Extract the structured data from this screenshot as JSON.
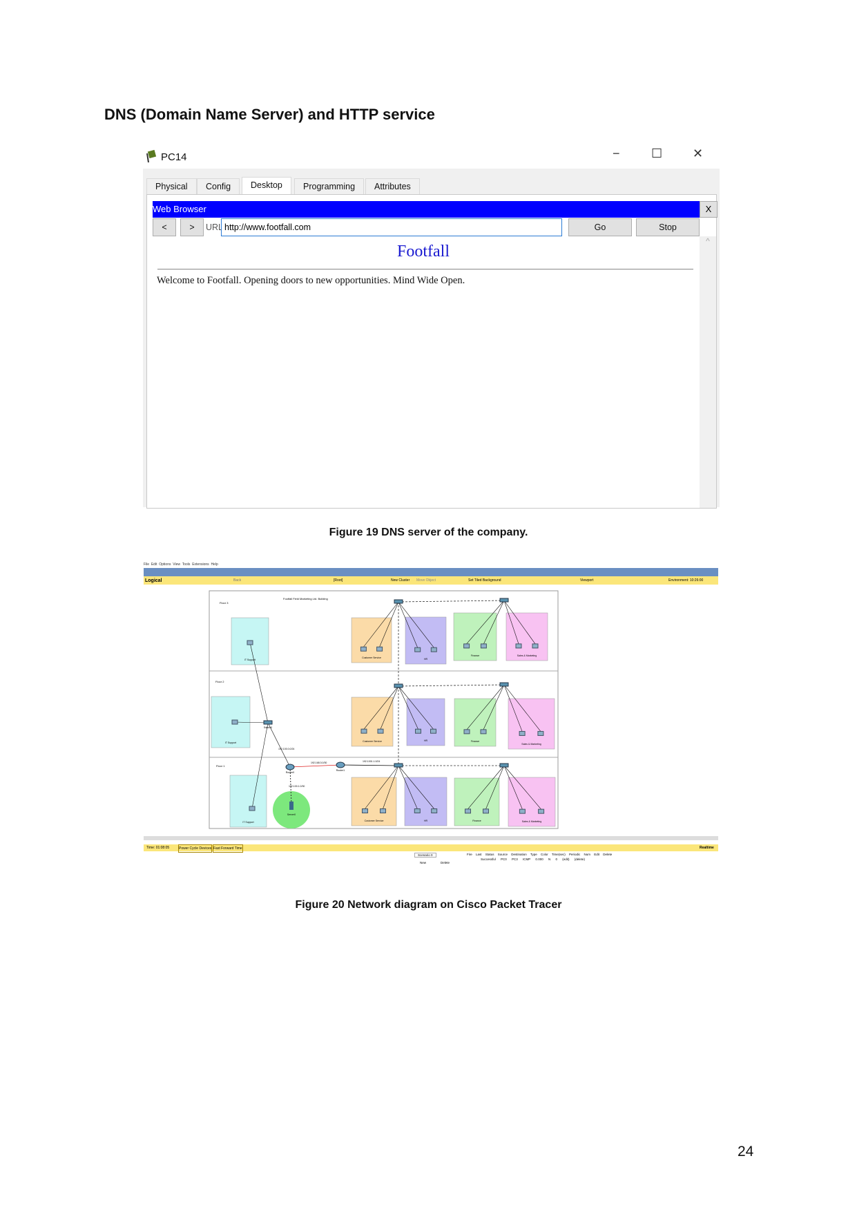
{
  "heading": "DNS (Domain Name Server) and HTTP service",
  "fig19": {
    "window_title": "PC14",
    "window_controls": {
      "minimize": "−",
      "maximize": "☐",
      "close": "✕"
    },
    "tabs": [
      {
        "label": "Physical"
      },
      {
        "label": "Config"
      },
      {
        "label": "Desktop",
        "active": true
      },
      {
        "label": "Programming"
      },
      {
        "label": "Attributes"
      }
    ],
    "browser": {
      "title": "Web Browser",
      "close": "X",
      "back": "<",
      "forward": ">",
      "url_label": "URL",
      "url": "http://www.footfall.com",
      "go": "Go",
      "stop": "Stop",
      "page_heading": "Footfall",
      "page_text": "Welcome to Footfall. Opening doors to new opportunities. Mind Wide Open.",
      "scroll_up": "^"
    },
    "caption": "Figure 19 DNS server of the company.",
    "colors": {
      "title_bar": "#0000ff",
      "heading": "#1a1ad0"
    }
  },
  "fig20": {
    "menu": [
      "File",
      "Edit",
      "Options",
      "View",
      "Tools",
      "Extensions",
      "Help"
    ],
    "mode": "Logical",
    "bar": [
      "Back",
      "[Root]",
      "New Cluster",
      "Move Object",
      "Set Tiled Background",
      "Viewport",
      "Environment: 10:26:00"
    ],
    "diagram_title": "Footfall Field Marketing Ltd. Building",
    "floors": [
      "Floor 3",
      "Floor 2",
      "Floor 1"
    ],
    "rooms": {
      "it": "IT Support",
      "cs": "Customer Service",
      "hr": "HR",
      "fin": "Finance",
      "sales": "Sales & Marketing"
    },
    "devices": {
      "switch0": "Switch0",
      "router0": "Router0",
      "router1": "Router1",
      "server0": "Server0"
    },
    "networks": [
      "192.100.0.0/24",
      "192.168.3.0/30",
      "192.1001.1.0/24",
      "192.100.1.0/30"
    ],
    "status": {
      "time": "Time: 01:08:05",
      "power": "Power Cycle Devices",
      "fast": "Fast Forward Time",
      "realtime": "Realtime"
    },
    "scenario": {
      "name": "Scenario 0",
      "new": "New",
      "delete": "Delete"
    },
    "pdu_headers": [
      "Fire",
      "Last Status",
      "Source",
      "Destination",
      "Type",
      "Color",
      "Time(sec)",
      "Periodic",
      "Num",
      "Edit",
      "Delete"
    ],
    "pdu_row": [
      "Successful",
      "PC0",
      "PC3",
      "ICMP",
      "",
      "0.000",
      "N",
      "0",
      "(edit)",
      "(delete)"
    ],
    "caption": "Figure 20 Network diagram on Cisco Packet Tracer",
    "colors": {
      "toolbar": "#6a8fc2",
      "yellow": "#fbe67a",
      "it": "#c6f6f4",
      "cs": "#fbdba8",
      "hr": "#c2bcf4",
      "fin": "#bff2bc",
      "sales": "#f8c2f2",
      "server": "#7de87d"
    }
  },
  "page_number": "24"
}
